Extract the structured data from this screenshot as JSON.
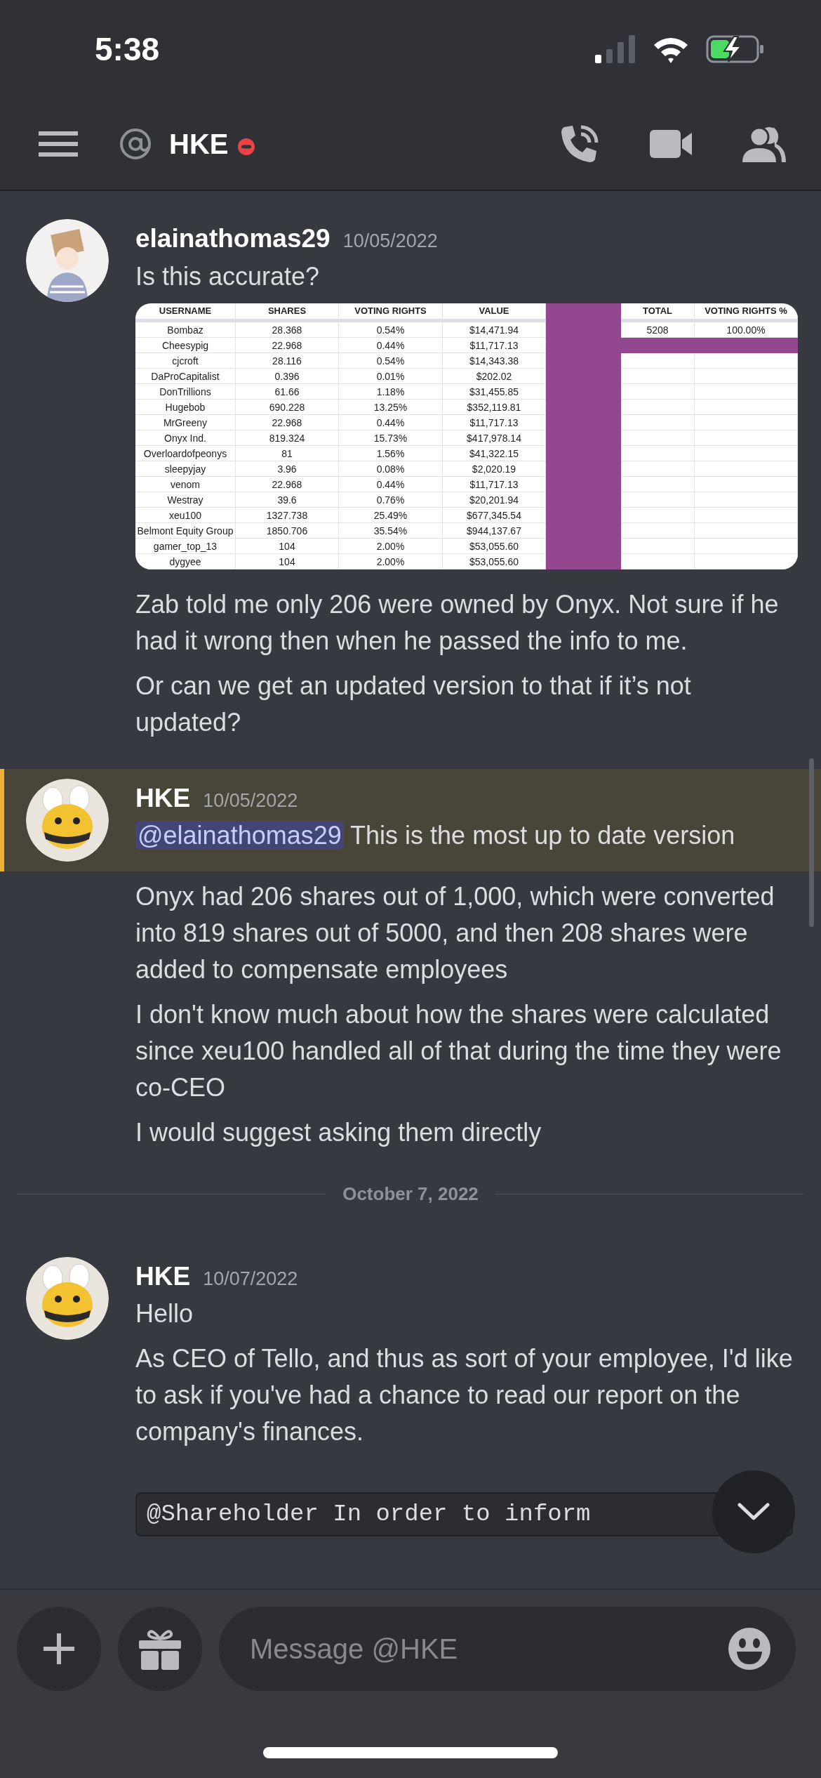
{
  "status_bar": {
    "time": "5:38"
  },
  "header": {
    "title": "HKE"
  },
  "messages": [
    {
      "kind": "message",
      "author": "elainathomas29",
      "date": "10/05/2022",
      "avatar": {
        "kind": "person"
      },
      "highlighted": false,
      "content": [
        {
          "kind": "text",
          "text": "Is this accurate?"
        },
        {
          "kind": "sheet",
          "columns": [
            "USERNAME",
            "SHARES",
            "VOTING RIGHTS",
            "VALUE"
          ],
          "rows": [
            [
              "Bombaz",
              "28.368",
              "0.54%",
              "$14,471.94"
            ],
            [
              "Cheesypig",
              "22.968",
              "0.44%",
              "$11,717.13"
            ],
            [
              "cjcroft",
              "28.116",
              "0.54%",
              "$14,343.38"
            ],
            [
              "DaProCapitalist",
              "0.396",
              "0.01%",
              "$202.02"
            ],
            [
              "DonTrillions",
              "61.66",
              "1.18%",
              "$31,455.85"
            ],
            [
              "Hugebob",
              "690.228",
              "13.25%",
              "$352,119.81"
            ],
            [
              "MrGreeny",
              "22.968",
              "0.44%",
              "$11,717.13"
            ],
            [
              "Onyx Ind.",
              "819.324",
              "15.73%",
              "$417,978.14"
            ],
            [
              "Overloardofpeonys",
              "81",
              "1.56%",
              "$41,322.15"
            ],
            [
              "sleepyjay",
              "3.96",
              "0.08%",
              "$2,020.19"
            ],
            [
              "venom",
              "22.968",
              "0.44%",
              "$11,717.13"
            ],
            [
              "Westray",
              "39.6",
              "0.76%",
              "$20,201.94"
            ],
            [
              "xeu100",
              "1327.738",
              "25.49%",
              "$677,345.54"
            ],
            [
              "Belmont Equity Group",
              "1850.706",
              "35.54%",
              "$944,137.67"
            ],
            [
              "gamer_top_13",
              "104",
              "2.00%",
              "$53,055.60"
            ],
            [
              "dygyee",
              "104",
              "2.00%",
              "$53,055.60"
            ]
          ],
          "side_columns": [
            "TOTAL",
            "VOTING RIGHTS %"
          ],
          "side_rows": [
            [
              "5208",
              "100.00%"
            ]
          ]
        },
        {
          "kind": "text",
          "text": "Zab told me only 206 were owned by Onyx. Not sure if he had it wrong then when he passed the info to me."
        },
        {
          "kind": "text",
          "text": "Or can we get an updated version to that if it’s not updated?"
        }
      ]
    },
    {
      "kind": "message",
      "author": "HKE",
      "date": "10/05/2022",
      "avatar": {
        "kind": "bee"
      },
      "highlighted": true,
      "content": [
        {
          "kind": "mention",
          "mention": "@elainathomas29",
          "text": " This is the most up to date version"
        }
      ]
    },
    {
      "kind": "continuation",
      "highlighted": false,
      "content": [
        {
          "kind": "text",
          "text": "Onyx had 206 shares out of 1,000, which were converted into 819 shares out of 5000, and then 208 shares were added to compensate employees"
        },
        {
          "kind": "text",
          "text": "I don't know much about how the shares were calculated since xeu100 handled all of that during the time they were co-CEO"
        },
        {
          "kind": "text",
          "text": "I would suggest asking them directly"
        }
      ]
    },
    {
      "kind": "divider",
      "text": "October 7, 2022"
    },
    {
      "kind": "message",
      "author": "HKE",
      "date": "10/07/2022",
      "avatar": {
        "kind": "bee"
      },
      "highlighted": false,
      "content": [
        {
          "kind": "text",
          "text": "Hello"
        },
        {
          "kind": "text",
          "text": "As CEO of Tello, and thus as sort of your employee, I'd like to ask if you've had a chance to read our report on the company's finances."
        },
        {
          "kind": "code",
          "text": "@Shareholder In order to inform"
        }
      ]
    }
  ],
  "composer": {
    "placeholder": "Message @HKE"
  }
}
